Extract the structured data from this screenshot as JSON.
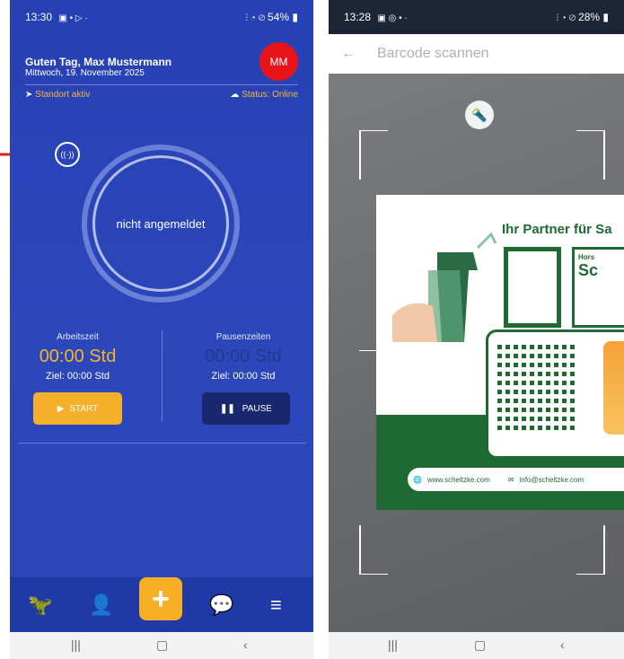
{
  "left": {
    "status": {
      "time": "13:30",
      "left_icons": "▣ • ▷ ·",
      "right": "54%"
    },
    "greeting": "Guten Tag, Max Mustermann",
    "date": "Mittwoch, 19. November 2025",
    "avatar": "MM",
    "location": "Standort aktiv",
    "status_online": "Status: Online",
    "nfc_icon_text": "((·))",
    "ring_text": "nicht angemeldet",
    "work_label": "Arbeitszeit",
    "work_time": "00:00 Std",
    "work_goal": "Ziel: 00:00 Std",
    "pause_label": "Pausenzeiten",
    "pause_time": "00:00 Std",
    "pause_goal": "Ziel: 00:00  Std",
    "start_label": "START",
    "pause_btn_label": "PAUSE",
    "tabs": [
      "dino-icon",
      "user-clock-icon",
      "plus-icon",
      "chat-icon",
      "menu-icon"
    ]
  },
  "right": {
    "status": {
      "time": "13:28",
      "right": "28%"
    },
    "title": "Barcode scannen",
    "card": {
      "partner": "Ihr Partner für Sa",
      "name_short": "Hors",
      "name_big": "Sc",
      "web": "www.scheltzke.com",
      "mail": "info@scheltzke.com"
    }
  },
  "colors": {
    "accent": "#f6ae24",
    "bg_blue": "#2a46b7",
    "avatar_red": "#e8141a",
    "arrow_red": "#e01e1e"
  }
}
